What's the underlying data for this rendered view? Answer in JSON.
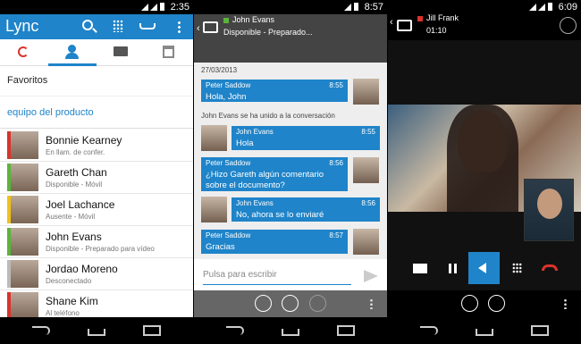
{
  "panel1": {
    "status_time": "2:35",
    "app_title": "Lync",
    "favorites_label": "Favoritos",
    "group_label": "equipo del producto",
    "contacts": [
      {
        "name": "Bonnie Kearney",
        "status": "En llam. de confer.",
        "presence_color": "#d9332b"
      },
      {
        "name": "Gareth Chan",
        "status": "Disponible - Móvil",
        "presence_color": "#5ab43a"
      },
      {
        "name": "Joel Lachance",
        "status": "Ausente - Móvil",
        "presence_color": "#f0c11b"
      },
      {
        "name": "John Evans",
        "status": "Disponible - Preparado para vídeo",
        "presence_color": "#5ab43a"
      },
      {
        "name": "Jordao Moreno",
        "status": "Desconectado",
        "presence_color": "#bbbbbb"
      },
      {
        "name": "Shane Kim",
        "status": "Al teléfono",
        "presence_color": "#d9332b"
      }
    ]
  },
  "panel2": {
    "status_time": "8:57",
    "contact_name": "John Evans",
    "contact_status": "Disponible - Preparado...",
    "date": "27/03/2013",
    "joined_notice": "John Evans se ha unido a la conversación",
    "messages": [
      {
        "from": "Peter Saddow",
        "time": "8:55",
        "text": "Hola, John"
      },
      {
        "from": "John Evans",
        "time": "8:55",
        "text": "Hola"
      },
      {
        "from": "Peter Saddow",
        "time": "8:56",
        "text": "¿Hizo Gareth algún comentario sobre el documento?"
      },
      {
        "from": "John Evans",
        "time": "8:56",
        "text": "No, ahora se lo enviaré"
      },
      {
        "from": "Peter Saddow",
        "time": "8:57",
        "text": "Gracias"
      }
    ],
    "input_placeholder": "Pulsa para escribir"
  },
  "panel3": {
    "status_time": "6:09",
    "contact_name": "Jill Frank",
    "call_duration": "01:10"
  },
  "colors": {
    "accent": "#1f84c9",
    "available": "#5ab43a",
    "busy": "#d9332b",
    "away": "#f0c11b"
  }
}
